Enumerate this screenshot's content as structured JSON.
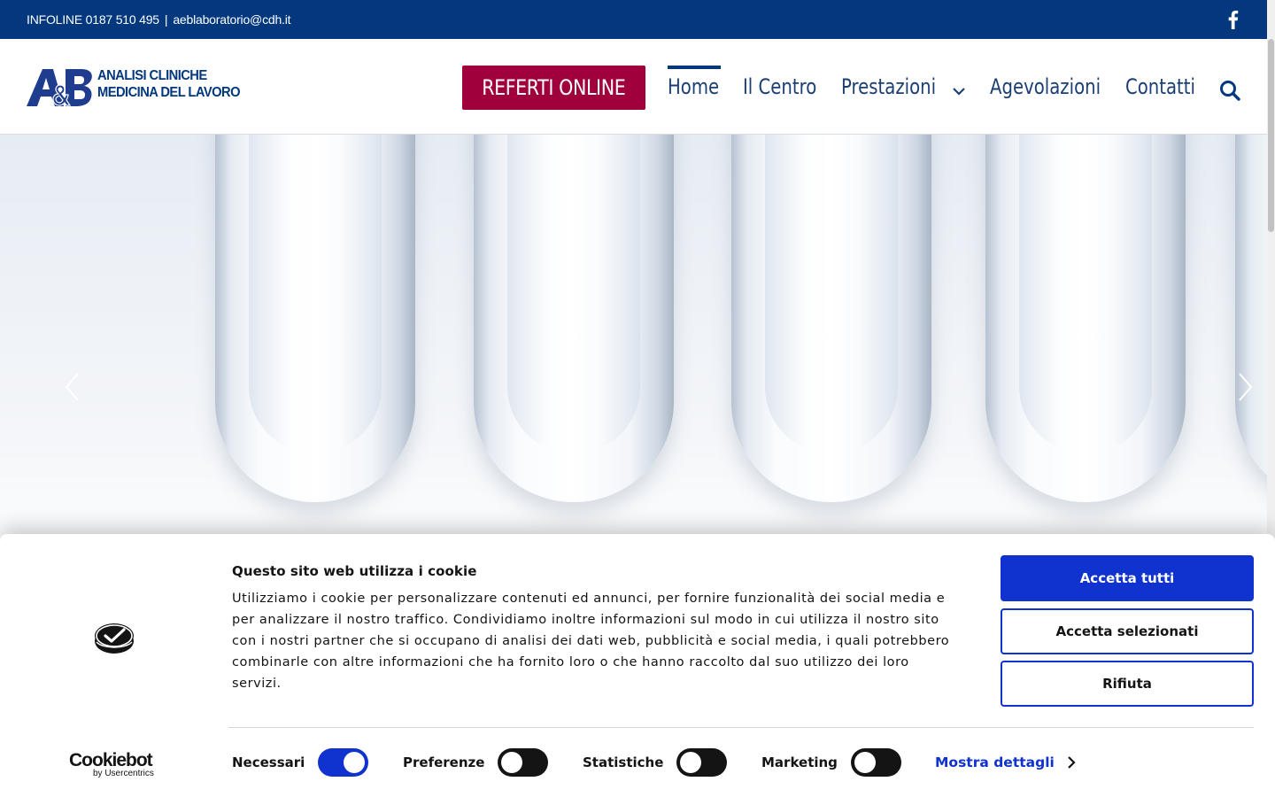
{
  "topbar": {
    "phone": "INFOLINE 0187 510 495",
    "separator": "|",
    "email": "aeblaboratorio@cdh.it",
    "social_icon": "facebook-icon"
  },
  "header": {
    "logo_mark": "A&B",
    "logo_line1": "ANALISI CLINICHE",
    "logo_line2": "MEDICINA DEL LAVORO",
    "cta_label": "REFERTI ONLINE",
    "nav": [
      {
        "label": "Home",
        "active": true
      },
      {
        "label": "Il Centro"
      },
      {
        "label": "Prestazioni",
        "has_dropdown": true
      },
      {
        "label": "Agevolazioni"
      },
      {
        "label": "Contatti"
      }
    ],
    "search_icon": "search-icon"
  },
  "hero": {
    "prev_icon": "chevron-left-icon",
    "next_icon": "chevron-right-icon"
  },
  "cookie": {
    "title": "Questo sito web utilizza i cookie",
    "text": "Utilizziamo i cookie per personalizzare contenuti ed annunci, per fornire funzionalità dei social media e per analizzare il nostro traffico. Condividiamo inoltre informazioni sul modo in cui utilizza il nostro sito con i nostri partner che si occupano di analisi dei dati web, pubblicità e social media, i quali potrebbero combinarle con altre informazioni che ha fornito loro o che hanno raccolto dal suo utilizzo dei loro servizi.",
    "accept_all": "Accetta tutti",
    "accept_selected": "Accetta selezionati",
    "deny": "Rifiuta",
    "categories": [
      {
        "label": "Necessari",
        "enabled": true
      },
      {
        "label": "Preferenze",
        "enabled": false
      },
      {
        "label": "Statistiche",
        "enabled": false
      },
      {
        "label": "Marketing",
        "enabled": false
      }
    ],
    "details_label": "Mostra dettagli",
    "brand_name": "Cookiebot",
    "brand_sub": "by Usercentrics"
  },
  "colors": {
    "brand_blue": "#03387f",
    "cta_red": "#a0003c",
    "cookie_blue": "#1032cf"
  }
}
